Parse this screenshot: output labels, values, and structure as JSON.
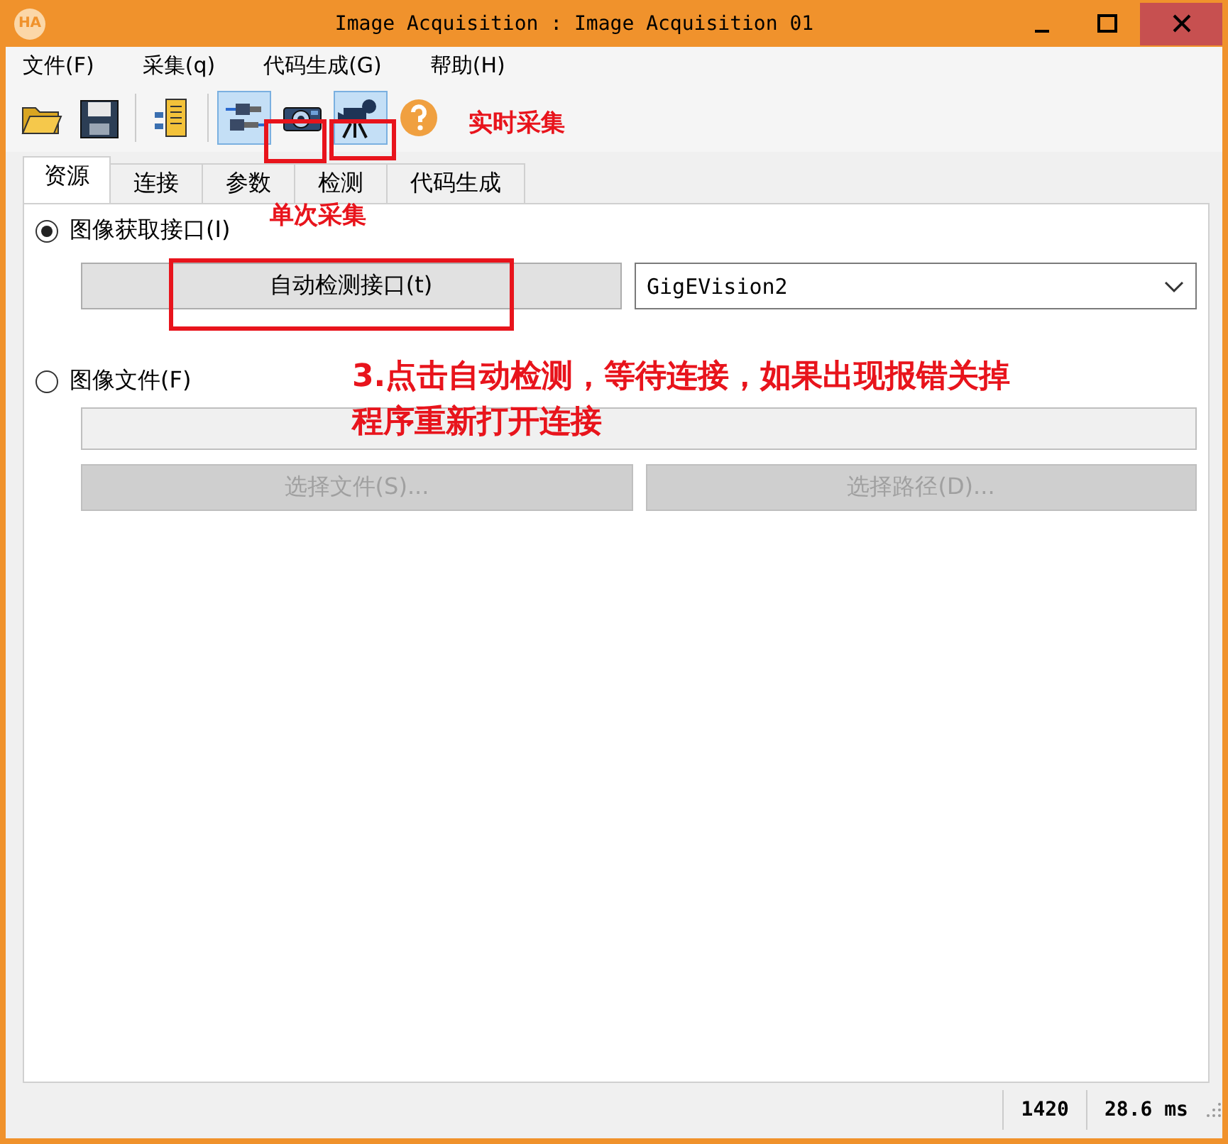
{
  "window": {
    "logo": "HA",
    "title": "Image Acquisition : Image Acquisition 01"
  },
  "menu": [
    "文件(F)",
    "采集(q)",
    "代码生成(G)",
    "帮助(H)"
  ],
  "toolbar": [
    {
      "kind": "folder",
      "pressed": false
    },
    {
      "kind": "save",
      "pressed": false
    },
    {
      "kind": "sep"
    },
    {
      "kind": "document",
      "pressed": false
    },
    {
      "kind": "sep"
    },
    {
      "kind": "connect",
      "pressed": true
    },
    {
      "kind": "camera",
      "pressed": false
    },
    {
      "kind": "video",
      "pressed": true
    },
    {
      "kind": "help",
      "pressed": false
    }
  ],
  "tabs": [
    {
      "label": "资源",
      "selected": true
    },
    {
      "label": "连接",
      "selected": false
    },
    {
      "label": "参数",
      "selected": false
    },
    {
      "label": "检测",
      "selected": false
    },
    {
      "label": "代码生成",
      "selected": false
    }
  ],
  "source": {
    "interface_radio": {
      "label": "图像获取接口(I)",
      "selected": true
    },
    "detect_button": {
      "label": "自动检测接口(t)",
      "disabled": false
    },
    "interface_select": {
      "value": "GigEVision2"
    },
    "file_radio": {
      "label": "图像文件(F)",
      "selected": false
    },
    "file_field": {
      "disabled": true
    },
    "buttons": [
      {
        "label": "选择文件(S)...",
        "disabled": true
      },
      {
        "label": "选择路径(D)...",
        "disabled": true
      }
    ]
  },
  "status_bar": [
    "1420",
    "28.6 ms"
  ],
  "annotations": [
    {
      "kind": "label",
      "text": "实时采集"
    },
    {
      "kind": "label",
      "text": "单次采集"
    },
    {
      "kind": "note",
      "lines": [
        "3.点击自动检测，等待连接，如果出现报错关掉",
        "程序重新打开连接"
      ]
    },
    {
      "kind": "box"
    },
    {
      "kind": "box"
    },
    {
      "kind": "box"
    }
  ]
}
